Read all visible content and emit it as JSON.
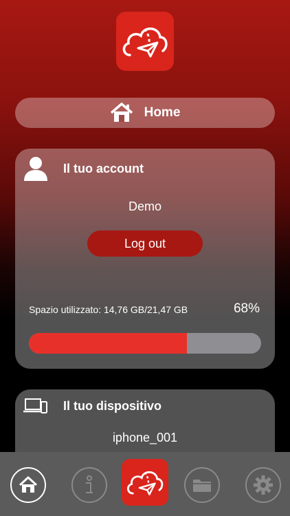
{
  "header": {
    "logo_icon": "cloud-paper-plane-icon",
    "brand_color": "#d9251c"
  },
  "home": {
    "label": "Home",
    "icon": "house-icon"
  },
  "account": {
    "title": "Il tuo account",
    "icon": "user-icon",
    "username": "Demo",
    "logout_label": "Log out",
    "storage_label": "Spazio utilizzato: 14,76 GB/21,47 GB",
    "storage_percent_label": "68%",
    "storage_fraction": 0.68
  },
  "device": {
    "title": "Il tuo dispositivo",
    "icon": "devices-icon",
    "name": "iphone_001"
  },
  "tabbar": {
    "items": [
      {
        "name": "home",
        "icon": "house-icon",
        "active": true
      },
      {
        "name": "info",
        "icon": "info-icon",
        "active": false
      },
      {
        "name": "upload",
        "icon": "cloud-paper-plane-icon",
        "active": false
      },
      {
        "name": "files",
        "icon": "folder-icon",
        "active": false
      },
      {
        "name": "settings",
        "icon": "gear-icon",
        "active": false
      }
    ]
  },
  "colors": {
    "accent": "#d9251c",
    "bar_fill": "#e8302a",
    "bar_track": "#8e8e93",
    "tabbar_bg": "#5b5b5b"
  }
}
